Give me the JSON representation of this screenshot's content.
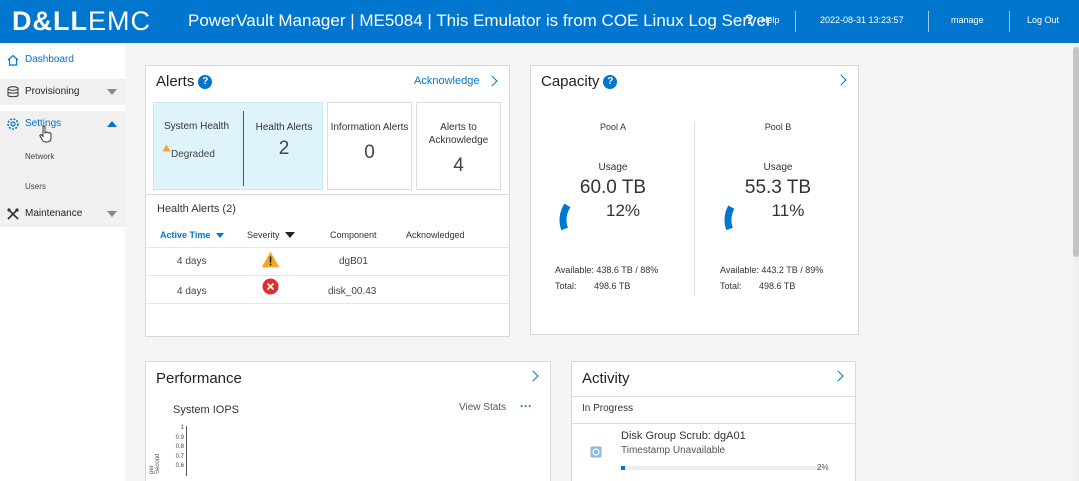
{
  "header": {
    "logo_bold": "D&LL",
    "logo_light": "EMC",
    "app_title": "PowerVault Manager | ME5084 | This Emulator is from COE Linux Log Server",
    "help_q": "?",
    "help_label": "Help",
    "datetime": "2022-08-31 13:23:57",
    "user": "manage",
    "logout": "Log Out"
  },
  "sidebar": {
    "items": [
      {
        "label": "Dashboard",
        "icon": "home-icon"
      },
      {
        "label": "Provisioning",
        "icon": "database-icon"
      },
      {
        "label": "Settings",
        "icon": "gear-icon"
      },
      {
        "label": "Maintenance",
        "icon": "tools-icon"
      }
    ],
    "settings_sub": [
      "Network",
      "Users"
    ]
  },
  "alerts": {
    "title": "Alerts",
    "acknowledge": "Acknowledge",
    "system_health_label": "System Health",
    "system_health_value": "Degraded",
    "tiles": [
      {
        "label": "Health Alerts",
        "value": "2"
      },
      {
        "label": "Information Alerts",
        "value": "0"
      },
      {
        "label": "Alerts to Acknowledge",
        "value": "4"
      }
    ],
    "list_title": "Health Alerts (2)",
    "columns": [
      "Active Time",
      "Severity",
      "Component",
      "Acknowledged"
    ],
    "rows": [
      {
        "time": "4 days",
        "severity": "warning",
        "component": "dgB01",
        "acknowledged": ""
      },
      {
        "time": "4 days",
        "severity": "error",
        "component": "disk_00.43",
        "acknowledged": ""
      }
    ]
  },
  "capacity": {
    "title": "Capacity",
    "pools": [
      {
        "name": "Pool A",
        "usage_label": "Usage",
        "usage_tb": "60.0 TB",
        "usage_pct": "12%",
        "usage_fraction": 0.12,
        "available_label": "Available:",
        "available": "438.6 TB / 88%",
        "total_label": "Total:",
        "total": "498.6 TB"
      },
      {
        "name": "Pool B",
        "usage_label": "Usage",
        "usage_tb": "55.3 TB",
        "usage_pct": "11%",
        "usage_fraction": 0.11,
        "available_label": "Available:",
        "available": "443.2 TB / 89%",
        "total_label": "Total:",
        "total": "498.6 TB"
      }
    ]
  },
  "performance": {
    "title": "Performance",
    "chart_title": "System IOPS",
    "view_stats": "View Stats",
    "more": "···",
    "y_axis_label": "per Second",
    "y_ticks": [
      "1",
      "0.9",
      "0.8",
      "0.7",
      "0.6"
    ]
  },
  "activity": {
    "title": "Activity",
    "section": "In Progress",
    "task_name": "Disk Group Scrub: dgA01",
    "task_time": "Timestamp Unavailable",
    "task_pct": "2%",
    "task_fraction": 0.02
  },
  "colors": {
    "brand": "#0076ce",
    "warning": "#f5a623",
    "error": "#d9302a",
    "tile_active": "#dff3fb"
  }
}
